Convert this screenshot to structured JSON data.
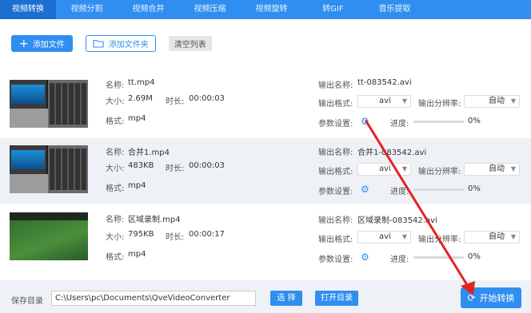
{
  "tabs": [
    "视频转换",
    "视频分割",
    "视频合并",
    "视频压缩",
    "视频旋转",
    "转GIF",
    "音乐提取"
  ],
  "toolbar": {
    "add_file": "添加文件",
    "add_folder": "添加文件夹",
    "clear_list": "清空列表"
  },
  "labels": {
    "name": "名称:",
    "size": "大小:",
    "duration": "时长:",
    "format": "格式:",
    "output_name": "输出名称:",
    "output_format": "输出格式:",
    "output_resolution": "输出分辨率:",
    "params": "参数设置:",
    "progress": "进度:"
  },
  "files": [
    {
      "name": "tt.mp4",
      "size": "2.69M",
      "duration": "00:00:03",
      "format": "mp4",
      "output_name": "tt-083542.avi",
      "output_format": "avi",
      "resolution": "自动",
      "progress": "0%",
      "progress_value": 0
    },
    {
      "name": "合并1.mp4",
      "size": "483KB",
      "duration": "00:00:03",
      "format": "mp4",
      "output_name": "合并1-083542.avi",
      "output_format": "avi",
      "resolution": "自动",
      "progress": "0%",
      "progress_value": 0
    },
    {
      "name": "区域录制.mp4",
      "size": "795KB",
      "duration": "00:00:17",
      "format": "mp4",
      "output_name": "区域录制-083542.avi",
      "output_format": "avi",
      "resolution": "自动",
      "progress": "0%",
      "progress_value": 0
    }
  ],
  "bottom": {
    "save_dir_label": "保存目录",
    "save_path": "C:\\Users\\pc\\Documents\\QveVideoConverter",
    "choose": "选 择",
    "open_dir": "打开目录",
    "start": "开始转换"
  },
  "colors": {
    "accent": "#2f8ef0",
    "annotation": "#e52222"
  }
}
